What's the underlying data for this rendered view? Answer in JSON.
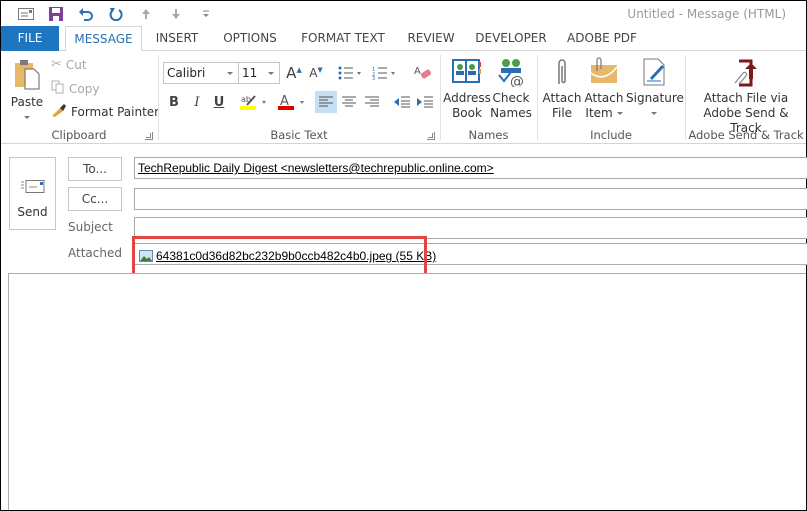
{
  "window": {
    "title": "Untitled - Message (HTML)"
  },
  "quick_access": [
    {
      "name": "app-icon",
      "label": ""
    },
    {
      "name": "save-icon",
      "label": ""
    },
    {
      "name": "undo-icon",
      "label": ""
    },
    {
      "name": "redo-icon",
      "label": ""
    },
    {
      "name": "up-arrow-icon",
      "label": ""
    },
    {
      "name": "down-arrow-icon",
      "label": ""
    },
    {
      "name": "customize-qat-icon",
      "label": ""
    }
  ],
  "tabs": [
    {
      "label": "FILE"
    },
    {
      "label": "MESSAGE"
    },
    {
      "label": "INSERT"
    },
    {
      "label": "OPTIONS"
    },
    {
      "label": "FORMAT TEXT"
    },
    {
      "label": "REVIEW"
    },
    {
      "label": "DEVELOPER"
    },
    {
      "label": "ADOBE PDF"
    }
  ],
  "ribbon": {
    "clipboard": {
      "label": "Clipboard",
      "paste": "Paste",
      "cut": "Cut",
      "copy": "Copy",
      "format_painter": "Format Painter"
    },
    "basic_text": {
      "label": "Basic Text",
      "font_name": "Calibri",
      "font_size": "11",
      "bold": "B",
      "italic": "I",
      "underline": "U",
      "highlight_color": "#ffff00",
      "font_color": "#e00000"
    },
    "names": {
      "label": "Names",
      "address_book_line1": "Address",
      "address_book_line2": "Book",
      "check_names_line1": "Check",
      "check_names_line2": "Names"
    },
    "include": {
      "label": "Include",
      "attach_file_line1": "Attach",
      "attach_file_line2": "File",
      "attach_item_line1": "Attach",
      "attach_item_line2": "Item",
      "signature": "Signature"
    },
    "adobe": {
      "label": "Adobe Send & Track",
      "button_line1": "Attach File via",
      "button_line2": "Adobe Send & Track"
    }
  },
  "compose": {
    "send_label": "Send",
    "to_button": "To...",
    "cc_button": "Cc...",
    "subject_label": "Subject",
    "attached_label": "Attached",
    "to_value": "TechRepublic Daily Digest <newsletters@techrepublic.online.com>",
    "cc_value": "",
    "subject_value": "",
    "attachment": {
      "filename": "64381c0d36d82bc232b9b0ccb482c4b0.jpeg",
      "size": "(55 KB)",
      "display": "64381c0d36d82bc232b9b0ccb482c4b0.jpeg (55 KB)"
    },
    "body": ""
  },
  "colors": {
    "file_tab": "#1e76c0",
    "active_tab_text": "#2a6fb3",
    "highlight_box": "#e04743"
  }
}
